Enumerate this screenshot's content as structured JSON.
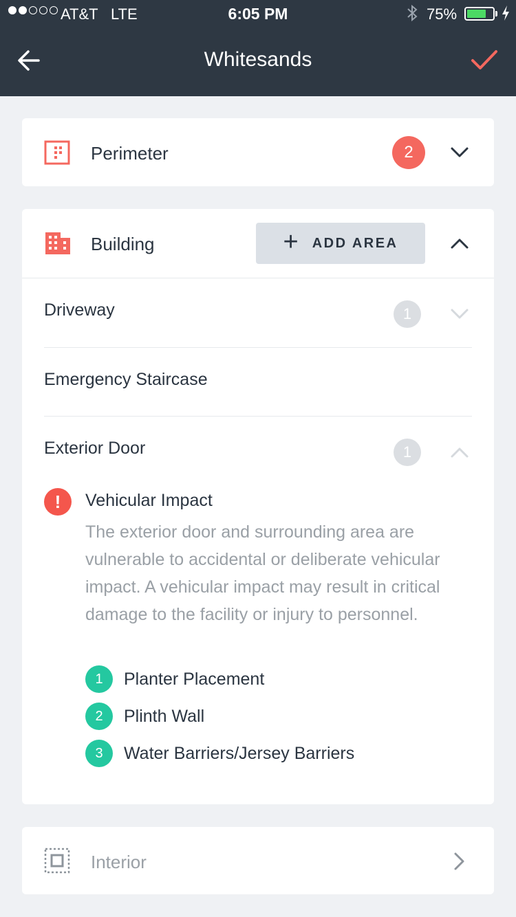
{
  "status_bar": {
    "carrier": "AT&T",
    "network": "LTE",
    "time": "6:05 PM",
    "battery_pct": "75%",
    "signal_bars_filled": 2,
    "signal_bars_total": 5
  },
  "nav": {
    "title": "Whitesands",
    "back_icon": "arrow-left-icon",
    "confirm_icon": "checkmark-icon",
    "accent": "#f4685f"
  },
  "categories": {
    "perimeter": {
      "label": "Perimeter",
      "badge": "2"
    },
    "building": {
      "label": "Building",
      "add_label": "ADD AREA"
    },
    "interior": {
      "label": "Interior"
    }
  },
  "areas": [
    {
      "label": "Driveway",
      "badge": "1"
    },
    {
      "label": "Emergency Staircase"
    },
    {
      "label": "Exterior Door",
      "badge": "1"
    }
  ],
  "risk": {
    "title": "Vehicular Impact",
    "description": "The exterior door and surrounding area are vulnerable to accidental or deliberate vehicular impact. A vehicular impact may result in critical damage to the facility or injury to personnel.",
    "mitigations": [
      {
        "num": "1",
        "label": "Planter Placement"
      },
      {
        "num": "2",
        "label": "Plinth Wall"
      },
      {
        "num": "3",
        "label": "Water Barriers/Jersey Barriers"
      }
    ]
  },
  "colors": {
    "nav_bg": "#2e3843",
    "danger": "#f4564c",
    "mitigation": "#24c8a0",
    "muted": "#9aa0a6"
  }
}
